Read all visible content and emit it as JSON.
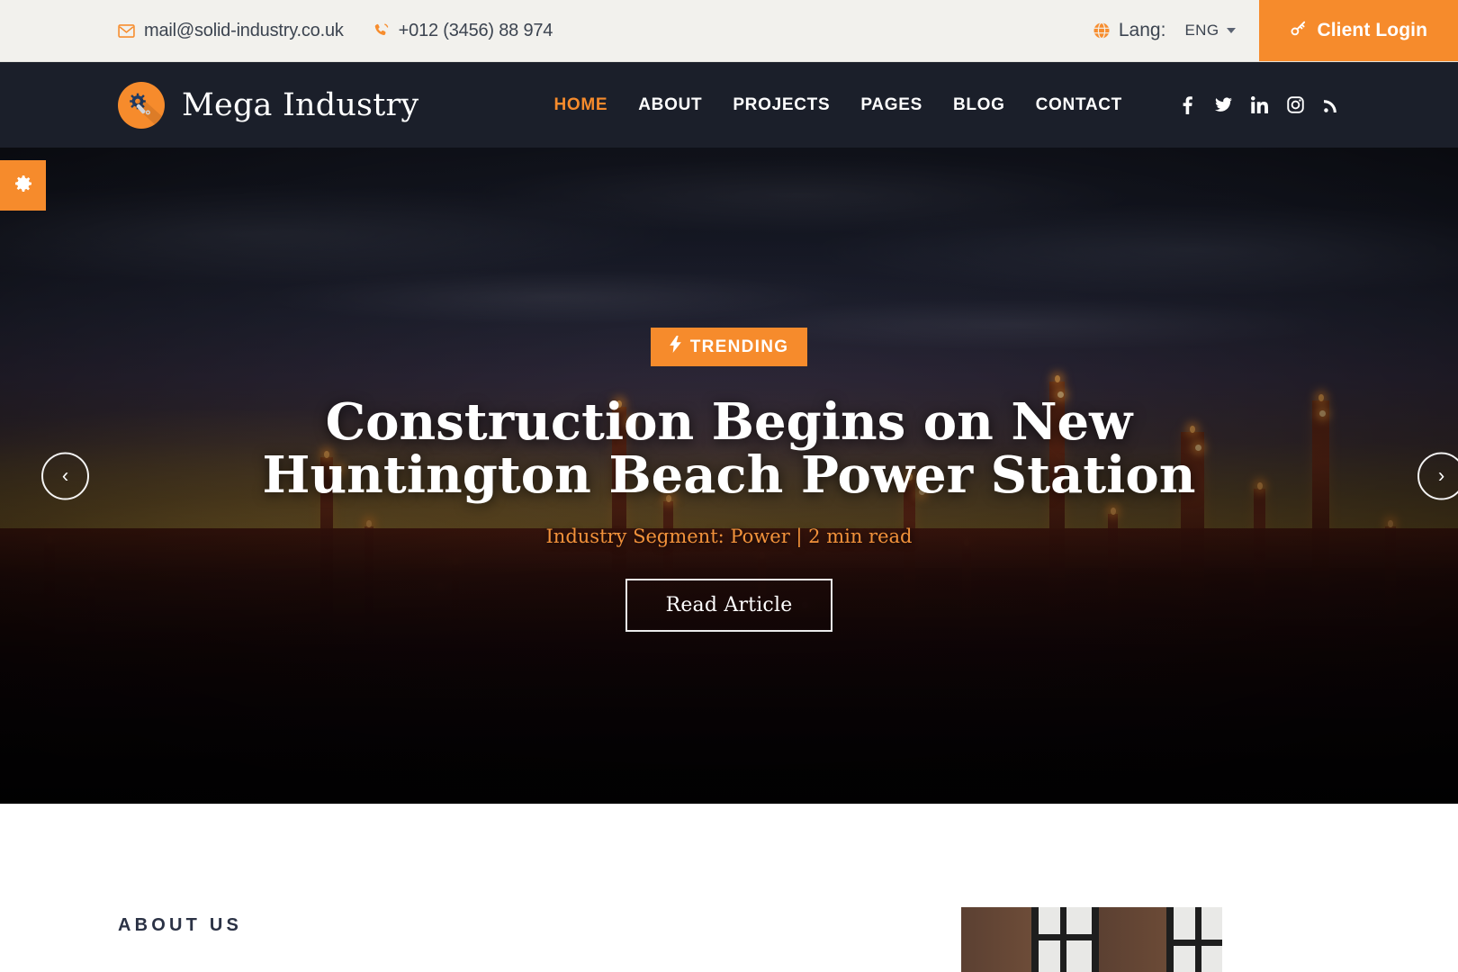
{
  "topbar": {
    "email": "mail@solid-industry.co.uk",
    "email_icon": "envelope-icon",
    "phone": "+012 (3456) 88 974",
    "phone_icon": "phone-ring-icon",
    "lang_label": "Lang:",
    "lang_value": "ENG",
    "globe_icon": "globe-icon",
    "client_login": "Client Login",
    "key_icon": "key-icon",
    "accent_color": "#f68b2c",
    "background_color": "#f2f1ed"
  },
  "header": {
    "brand_name": "Mega Industry",
    "logo_icon": "wrench-gear-icon",
    "background_color": "#1b1f2a",
    "nav": [
      {
        "label": "HOME",
        "active": true
      },
      {
        "label": "ABOUT",
        "active": false
      },
      {
        "label": "PROJECTS",
        "active": false
      },
      {
        "label": "PAGES",
        "active": false
      },
      {
        "label": "BLOG",
        "active": false
      },
      {
        "label": "CONTACT",
        "active": false
      }
    ],
    "social": [
      {
        "name": "facebook-icon",
        "glyph": "f"
      },
      {
        "name": "twitter-icon",
        "glyph": "t"
      },
      {
        "name": "linkedin-icon",
        "glyph": "in"
      },
      {
        "name": "instagram-icon",
        "glyph": "ig"
      },
      {
        "name": "rss-icon",
        "glyph": "rss"
      }
    ]
  },
  "settings_tab": {
    "icon": "gear-icon",
    "color": "#f68b2c"
  },
  "hero": {
    "badge": "TRENDING",
    "badge_icon": "lightning-bolt-icon",
    "title": "Construction Begins on New Huntington Beach Power Station",
    "meta": "Industry Segment: Power | 2 min read",
    "button": "Read Article",
    "prev_arrow": "‹",
    "next_arrow": "›",
    "meta_color": "#f2923b"
  },
  "about": {
    "label": "ABOUT US",
    "photo_alt": "industrial-brick-wall-windows"
  }
}
